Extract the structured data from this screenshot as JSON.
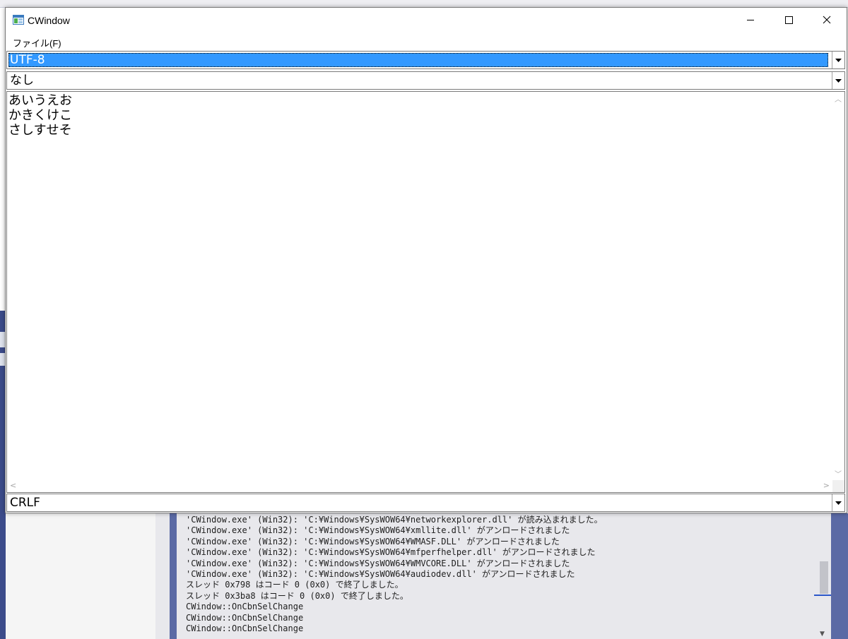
{
  "window": {
    "title": "CWindow",
    "menu": {
      "file_label": "ファイル(F)"
    }
  },
  "encoding": {
    "selected": "UTF-8"
  },
  "bom": {
    "selected": "なし"
  },
  "editor": {
    "lines": [
      "あいうえお",
      "かきくけこ",
      "さしすせそ"
    ]
  },
  "newline": {
    "selected": "CRLF"
  },
  "output": {
    "lines": [
      "'CWindow.exe' (Win32): 'C:¥Windows¥SysWOW64¥networkexplorer.dll' が読み込まれました。",
      "'CWindow.exe' (Win32): 'C:¥Windows¥SysWOW64¥xmllite.dll' がアンロードされました",
      "'CWindow.exe' (Win32): 'C:¥Windows¥SysWOW64¥WMASF.DLL' がアンロードされました",
      "'CWindow.exe' (Win32): 'C:¥Windows¥SysWOW64¥mfperfhelper.dll' がアンロードされました",
      "'CWindow.exe' (Win32): 'C:¥Windows¥SysWOW64¥WMVCORE.DLL' がアンロードされました",
      "'CWindow.exe' (Win32): 'C:¥Windows¥SysWOW64¥audiodev.dll' がアンロードされました",
      "スレッド 0x798 はコード 0 (0x0) で終了しました。",
      "スレッド 0x3ba8 はコード 0 (0x0) で終了しました。",
      "CWindow::OnCbnSelChange",
      "CWindow::OnCbnSelChange",
      "CWindow::OnCbnSelChange"
    ]
  },
  "colors": {
    "selection": "#3399ff",
    "ide_blue": "#5b6aa5",
    "output_bg": "#e8e8ec"
  },
  "icons": {
    "app": "window-app-icon",
    "minimize": "minimize-icon",
    "maximize": "maximize-icon",
    "close": "close-icon",
    "dropdown": "chevron-down-icon"
  }
}
